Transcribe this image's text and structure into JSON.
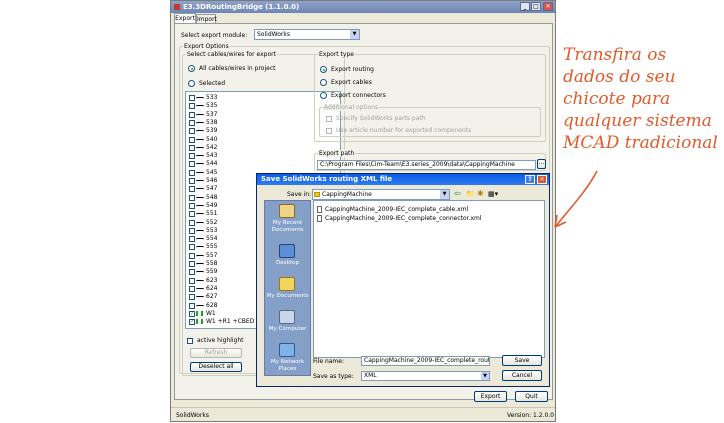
{
  "window": {
    "title": "E3.3DRoutingBridge (1.1.0.0)",
    "min": "_",
    "max": "□",
    "close": "✕"
  },
  "tabs": [
    {
      "label": "Export"
    },
    {
      "label": "Import"
    }
  ],
  "export_module": {
    "label": "Select export module:",
    "value": "SolidWorks"
  },
  "export_options": {
    "label": "Export Options",
    "cables_group": "Select cables/wires for export",
    "all_cables": "All cables/wires in project",
    "selected": "Selected",
    "items": [
      "533",
      "535",
      "537",
      "538",
      "539",
      "540",
      "542",
      "543",
      "544",
      "545",
      "546",
      "547",
      "548",
      "549",
      "551",
      "552",
      "553",
      "554",
      "555",
      "557",
      "558",
      "559",
      "623",
      "624",
      "627",
      "628",
      "W1",
      "W1 +R1 +CBED"
    ],
    "active_highlight": "active highlight",
    "refresh": "Refresh",
    "deselect_all": "Deselect all"
  },
  "export_type": {
    "label": "Export type",
    "routing": "Export routing",
    "cables": "Export cables",
    "connectors": "Export connectors",
    "additional": "Additional options",
    "specify_parts": "Specify SolidWorks parts path",
    "use_article": "Use article number for exported components"
  },
  "export_path": {
    "label": "Export path",
    "value": "C:\\Program Files\\Cim-Team\\E3.series_2009\\data\\CappingMachine",
    "browse": "..."
  },
  "buttons": {
    "export": "Export",
    "quit": "Quit"
  },
  "status": {
    "left": "SolidWorks",
    "right": "Version: 1.2.0.0"
  },
  "dialog": {
    "title": "Save SolidWorks routing XML file",
    "help": "?",
    "close": "✕",
    "save_in_label": "Save in:",
    "save_in_value": "CappingMachine",
    "toolbar": [
      "⇦",
      "📁",
      "✱",
      "▦▾"
    ],
    "places": [
      "My Recent Documents",
      "Desktop",
      "My Documents",
      "My Computer",
      "My Network Places"
    ],
    "files": [
      "CappingMachine_2009-IEC_complete_cable.xml",
      "CappingMachine_2009-IEC_complete_connector.xml"
    ],
    "file_name_label": "File name:",
    "file_name_value": "CappingMachine_2009-IEC_complete_routing.x",
    "save_type_label": "Save as type:",
    "save_type_value": "XML",
    "save": "Save",
    "cancel": "Cancel"
  },
  "annotation": {
    "lines": [
      "Transfira os",
      "dados do seu",
      "chicote para",
      "qualquer sistema",
      "MCAD tradicional"
    ],
    "color": "#e25a2b"
  }
}
